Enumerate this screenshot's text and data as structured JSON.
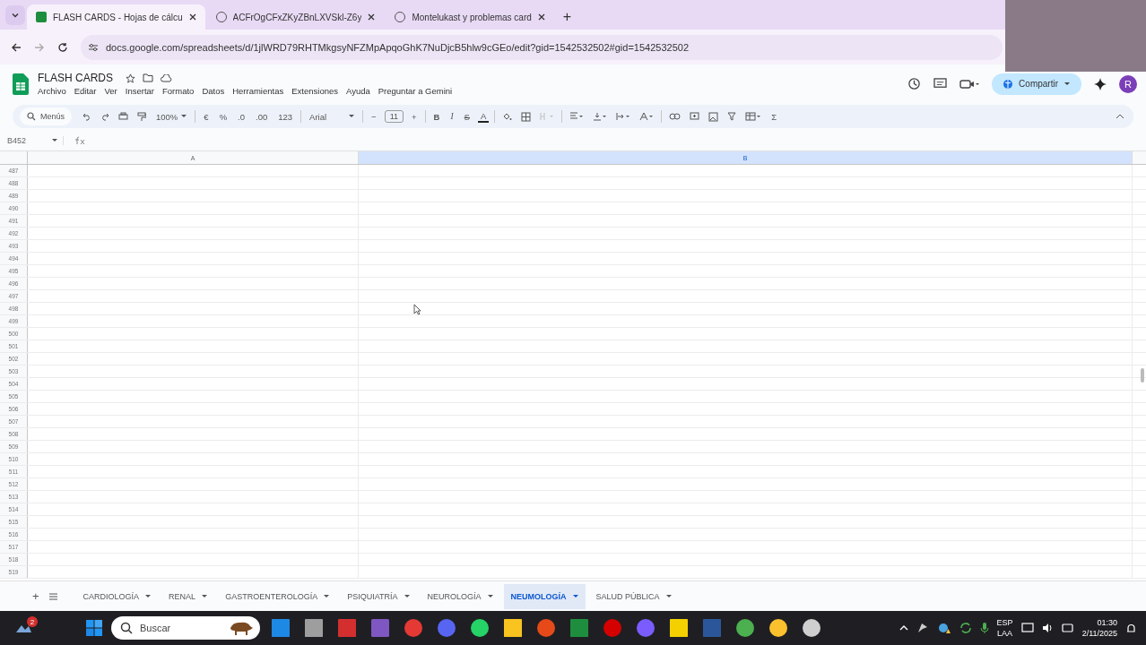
{
  "browser": {
    "tabs": [
      {
        "title": "FLASH CARDS - Hojas de cálcu",
        "selected": true
      },
      {
        "title": "ACFrOgCFxZKyZBnLXVSkl-Z6y",
        "selected": false
      },
      {
        "title": "Montelukast y problemas card",
        "selected": false
      }
    ],
    "new_tab": "+",
    "url": "docs.google.com/spreadsheets/d/1jlWRD79RHTMkgsyNFZMpApqoGhK7NuDjcB5hlw9cGEo/edit?gid=1542532502#gid=1542532502"
  },
  "doc": {
    "title": "FLASH CARDS",
    "menus": [
      "Archivo",
      "Editar",
      "Ver",
      "Insertar",
      "Formato",
      "Datos",
      "Herramientas",
      "Extensiones",
      "Ayuda",
      "Preguntar a Gemini"
    ],
    "share": "Compartir",
    "avatar": "R"
  },
  "toolbar": {
    "search_placeholder": "Menús",
    "zoom": "100%",
    "format_buttons": [
      "€",
      "%",
      ".0",
      ".00",
      "123"
    ],
    "font": "Arial",
    "font_size": "11",
    "minus": "−",
    "plus": "+",
    "bold": "B",
    "italic": "I",
    "strike": "S",
    "text_color": "A",
    "sum": "Σ"
  },
  "formula_bar": {
    "cell": "B452"
  },
  "grid": {
    "columns": [
      {
        "label": "A",
        "selected": false
      },
      {
        "label": "B",
        "selected": true
      }
    ],
    "rows": [
      "487",
      "488",
      "489",
      "490",
      "491",
      "492",
      "493",
      "494",
      "495",
      "496",
      "497",
      "498",
      "499",
      "500",
      "501",
      "502",
      "503",
      "504",
      "505",
      "506",
      "507",
      "508",
      "509",
      "510",
      "511",
      "512",
      "513",
      "514",
      "515",
      "516",
      "517",
      "518",
      "519"
    ]
  },
  "sheets": {
    "add": "+",
    "tabs": [
      {
        "label": "CARDIOLOGÍA",
        "selected": false
      },
      {
        "label": "RENAL",
        "selected": false
      },
      {
        "label": "GASTROENTEROLOGÍA",
        "selected": false
      },
      {
        "label": "PSIQUIATRÍA",
        "selected": false
      },
      {
        "label": "NEUROLOGÍA",
        "selected": false
      },
      {
        "label": "NEUMOLOGÍA",
        "selected": true
      },
      {
        "label": "SALUD PÚBLICA",
        "selected": false
      }
    ]
  },
  "taskbar": {
    "widget_badge": "2",
    "search_placeholder": "Buscar",
    "language": "ESP",
    "layout": "LAA",
    "time": "01:30",
    "date": "2/11/2025"
  }
}
